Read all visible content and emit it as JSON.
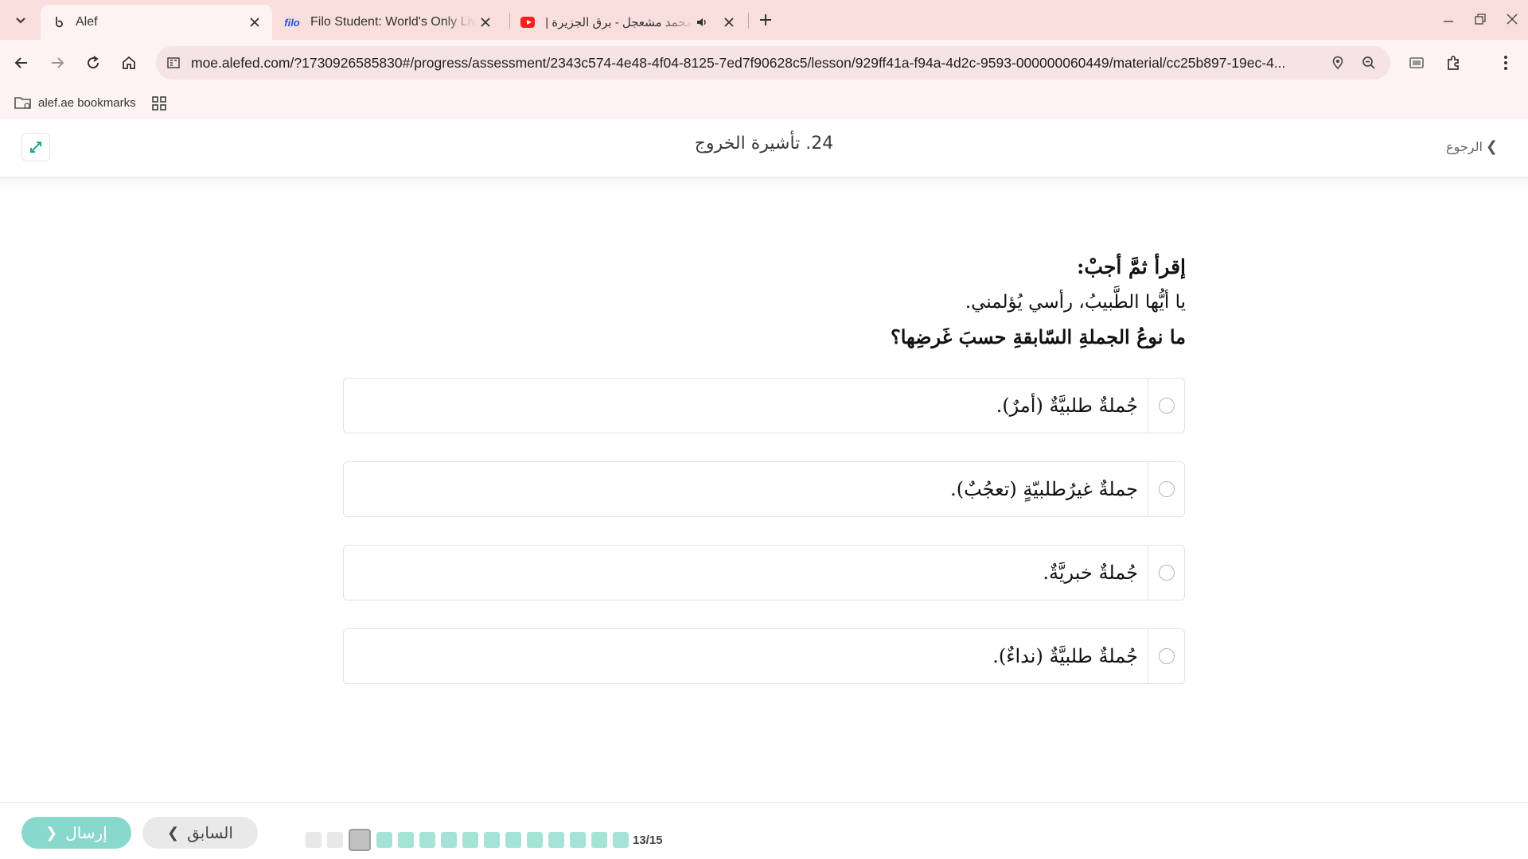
{
  "browser": {
    "tabs": [
      {
        "title": "Alef",
        "favicon": "alef-icon",
        "active": true
      },
      {
        "title": "Filo Student: World's Only Live Instant Tutoring",
        "favicon": "filo-icon",
        "favicon_text": "filo"
      },
      {
        "title": "محمد مشعجل - برق الجزيرة | e",
        "favicon": "youtube-icon",
        "audio": true
      }
    ],
    "url": "moe.alefed.com/?1730926585830#/progress/assessment/2343c574-4e48-4f04-8125-7ed7f90628c5/lesson/929ff41a-f94a-4d2c-9593-000000060449/material/cc25b897-19ec-4...",
    "bookmarks": [
      {
        "label": "alef.ae bookmarks"
      }
    ],
    "theme_color": "#f9dede"
  },
  "header": {
    "title": "24. تأشيرة الخروج",
    "back_label": "الرجوع"
  },
  "question": {
    "instruction": "إقرأ ثمَّ أجبْ:",
    "sentence": "يا أيُّها الطَّبيبُ، رأسي يُؤلمني.",
    "prompt": "ما نوعُ الجملةِ السّابقةِ حسبَ غَرضِها؟",
    "options": [
      {
        "text": "جُملةٌ طلبيَّةٌ (أمرٌ)."
      },
      {
        "text": "جملةٌ غيرُطلبيّةٍ (تعجُبٌ)."
      },
      {
        "text": "جُملةٌ خبريَّةٌ."
      },
      {
        "text": "جُملةٌ طلبيَّةٌ (نداءٌ)."
      }
    ]
  },
  "footer": {
    "submit_label": "إرسال",
    "prev_label": "السابق",
    "progress_text": "13/15",
    "progress_current": 13,
    "progress_total": 15,
    "accent_color": "#88d9cc"
  }
}
